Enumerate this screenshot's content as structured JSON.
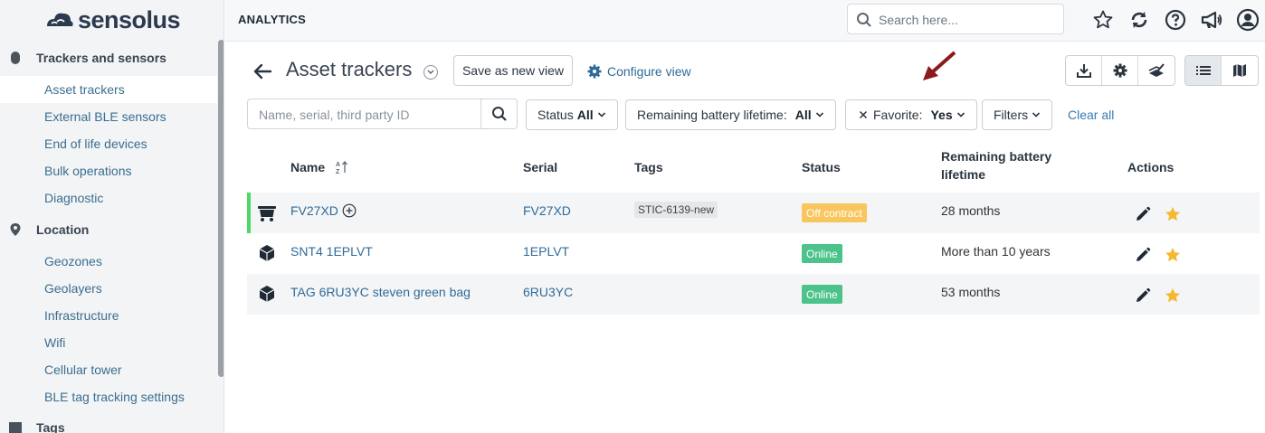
{
  "brand": {
    "name": "sensolus"
  },
  "sidebar": {
    "sections": [
      {
        "label": "Trackers and sensors",
        "items": [
          "Asset trackers",
          "External BLE sensors",
          "End of life devices",
          "Bulk operations",
          "Diagnostic"
        ]
      },
      {
        "label": "Location",
        "items": [
          "Geozones",
          "Geolayers",
          "Infrastructure",
          "Wifi",
          "Cellular tower",
          "BLE tag tracking settings"
        ]
      },
      {
        "label": "Tags",
        "items": []
      }
    ],
    "active_item": "Asset trackers"
  },
  "topbar": {
    "title": "ANALYTICS",
    "search_placeholder": "Search here...",
    "icons": [
      "star-icon",
      "refresh-icon",
      "help-icon",
      "megaphone-icon",
      "user-icon"
    ]
  },
  "page": {
    "title": "Asset trackers",
    "save_view_label": "Save as new view",
    "configure_view_label": "Configure view"
  },
  "filters": {
    "search_placeholder": "Name, serial, third party ID",
    "status": {
      "label": "Status",
      "value": "All"
    },
    "battery": {
      "label": "Remaining battery lifetime:",
      "value": "All"
    },
    "favorite": {
      "label": "Favorite:",
      "value": "Yes"
    },
    "more_label": "Filters",
    "clear_label": "Clear all"
  },
  "table": {
    "headers": {
      "name": "Name",
      "serial": "Serial",
      "tags": "Tags",
      "status": "Status",
      "battery_line1": "Remaining battery",
      "battery_line2": "lifetime",
      "actions": "Actions"
    },
    "rows": [
      {
        "name": "FV27XD",
        "serial": "FV27XD",
        "tag": "STIC-6139-new",
        "status": "Off contract",
        "battery": "28 months"
      },
      {
        "name": "SNT4 1EPLVT",
        "serial": "1EPLVT",
        "tag": "",
        "status": "Online",
        "battery": "More than 10 years"
      },
      {
        "name": "TAG 6RU3YC steven green bag",
        "serial": "6RU3YC",
        "tag": "",
        "status": "Online",
        "battery": "53 months"
      }
    ]
  },
  "colors": {
    "accent": "#2f6b99",
    "online": "#4cc38a",
    "off_contract": "#f8c65d",
    "favorite": "#f5b82e",
    "arrow": "#8b1a1a"
  }
}
